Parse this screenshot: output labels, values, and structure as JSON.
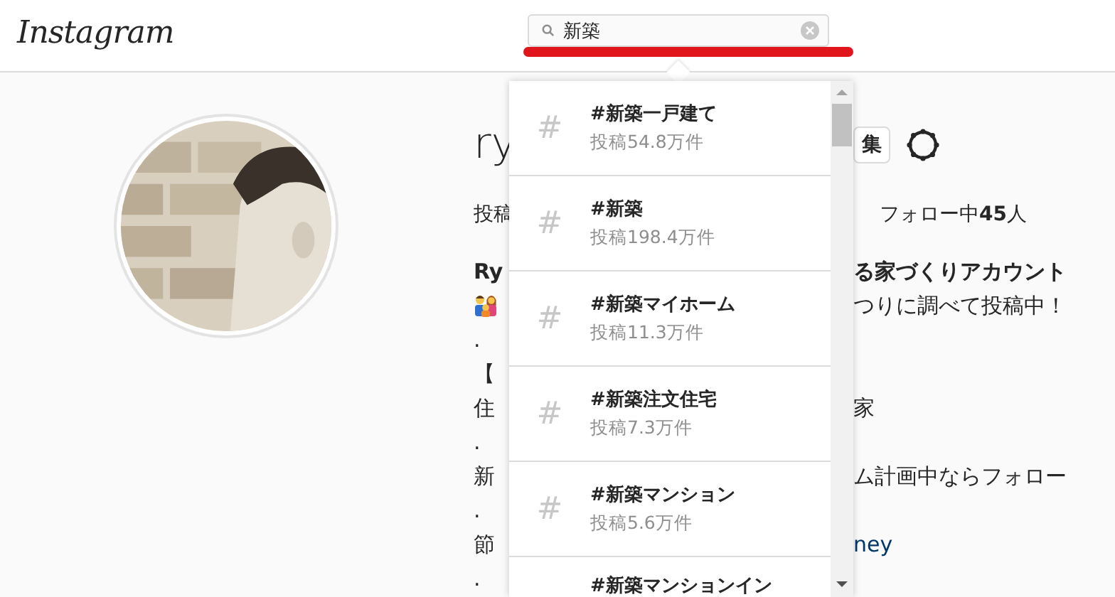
{
  "header": {
    "logo": "Instagram",
    "search": {
      "value": "新築"
    }
  },
  "profile": {
    "username": "ry",
    "edit_button": "集",
    "stats": [
      "投稿",
      "フォロー中**45**人"
    ],
    "bio": [
      {
        "left": "Ry",
        "right": "る家づくりアカウント",
        "bold": true
      },
      {
        "left_icon": true,
        "right": "つりに調べて投稿中！"
      },
      {
        "left": "."
      },
      {
        "left": "【"
      },
      {
        "left": "住",
        "right": "家"
      },
      {
        "left": "."
      },
      {
        "left": "新",
        "right": "ム計画中ならフォロー"
      },
      {
        "left": "."
      },
      {
        "left": "節",
        "right": "ney",
        "link": true
      },
      {
        "left": "."
      }
    ]
  },
  "suggestions": [
    {
      "symbol": "#",
      "tag": "#新築一戸建て",
      "count": "投稿54.8万件"
    },
    {
      "symbol": "#",
      "tag": "#新築",
      "count": "投稿198.4万件"
    },
    {
      "symbol": "#",
      "tag": "#新築マイホーム",
      "count": "投稿11.3万件"
    },
    {
      "symbol": "#",
      "tag": "#新築注文住宅",
      "count": "投稿7.3万件"
    },
    {
      "symbol": "#",
      "tag": "#新築マンション",
      "count": "投稿5.6万件"
    },
    {
      "tag": "#新築マンションイン"
    }
  ]
}
